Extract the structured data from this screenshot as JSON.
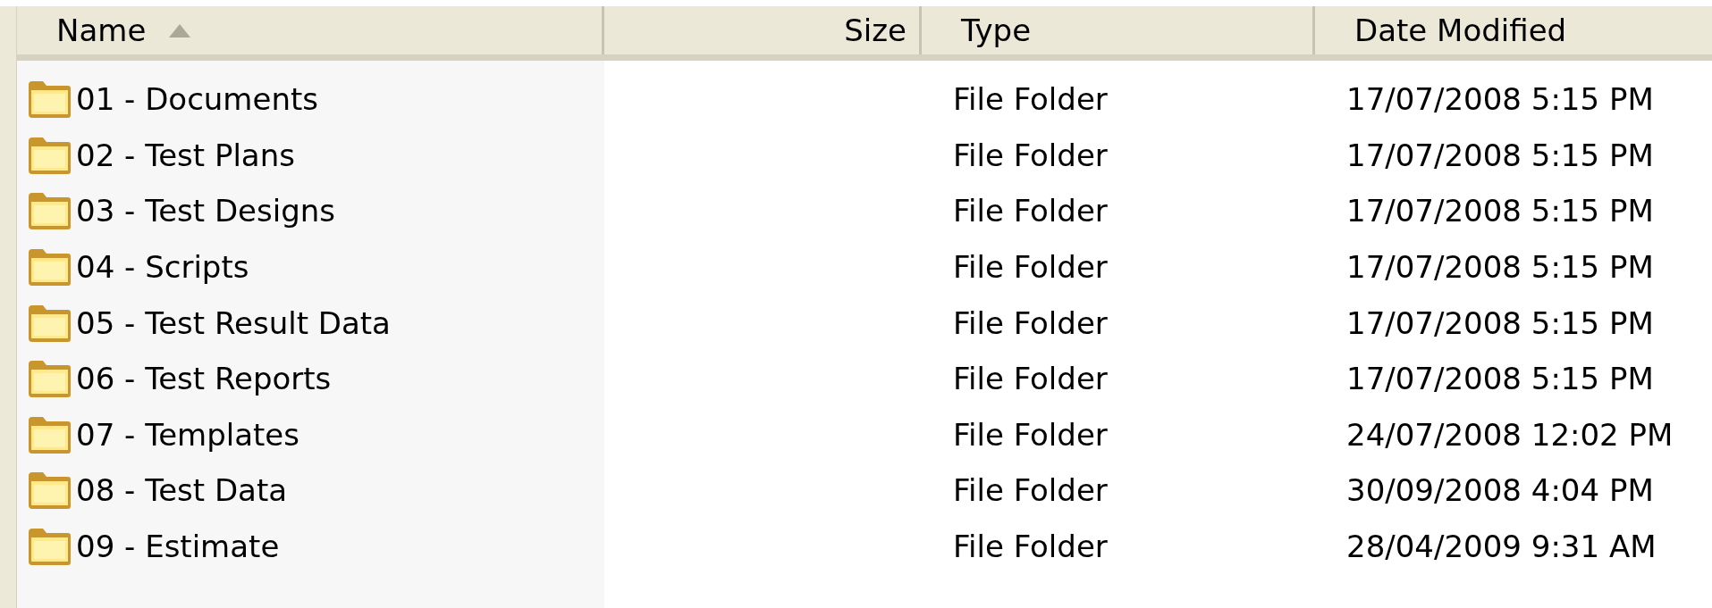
{
  "columns": [
    {
      "label": "Name",
      "sorted": true
    },
    {
      "label": "Size",
      "sorted": false
    },
    {
      "label": "Type",
      "sorted": false
    },
    {
      "label": "Date Modified",
      "sorted": false
    }
  ],
  "rows": [
    {
      "name": "01 - Documents",
      "type": "File Folder",
      "date": "17/07/2008 5:15 PM"
    },
    {
      "name": "02 - Test Plans",
      "type": "File Folder",
      "date": "17/07/2008 5:15 PM"
    },
    {
      "name": "03 - Test Designs",
      "type": "File Folder",
      "date": "17/07/2008 5:15 PM"
    },
    {
      "name": "04 - Scripts",
      "type": "File Folder",
      "date": "17/07/2008 5:15 PM"
    },
    {
      "name": "05 - Test Result Data",
      "type": "File Folder",
      "date": "17/07/2008 5:15 PM"
    },
    {
      "name": "06 - Test Reports",
      "type": "File Folder",
      "date": "17/07/2008 5:15 PM"
    },
    {
      "name": "07 - Templates",
      "type": "File Folder",
      "date": "24/07/2008 12:02 PM"
    },
    {
      "name": "08 - Test Data",
      "type": "File Folder",
      "date": "30/09/2008 4:04 PM"
    },
    {
      "name": "09 - Estimate",
      "type": "File Folder",
      "date": "28/04/2009 9:31 AM"
    }
  ]
}
